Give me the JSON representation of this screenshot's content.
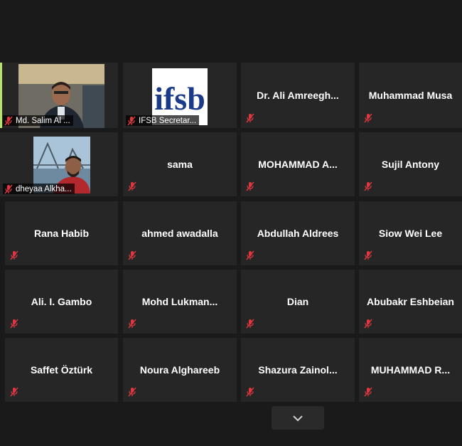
{
  "participants": [
    {
      "name": "Md. Salim Al ...",
      "type": "video"
    },
    {
      "name": "IFSB Secretar...",
      "type": "logo",
      "logo_text": "ifsb"
    },
    {
      "name": "Dr. Ali  Amreegh..."
    },
    {
      "name": "Muhammad Musa"
    },
    {
      "name": "dheyaa Alkha...",
      "type": "video"
    },
    {
      "name": "sama"
    },
    {
      "name": "MOHAMMAD  A..."
    },
    {
      "name": "Sujil Antony"
    },
    {
      "name": "Rana Habib"
    },
    {
      "name": "ahmed awadalla"
    },
    {
      "name": "Abdullah Aldrees"
    },
    {
      "name": "Siow Wei Lee"
    },
    {
      "name": "Ali. I. Gambo"
    },
    {
      "name": "Mohd  Lukman..."
    },
    {
      "name": "Dian"
    },
    {
      "name": "Abubakr Eshbeian"
    },
    {
      "name": "Saffet Öztürk"
    },
    {
      "name": "Noura Alghareeb"
    },
    {
      "name": "Shazura  Zainol..."
    },
    {
      "name": "MUHAMMAD  R..."
    }
  ],
  "colors": {
    "muted_icon": "#e0383e",
    "active_border": "#b6e36b",
    "tile_bg": "#262626"
  },
  "icons": {
    "mic": "mic-muted-icon",
    "scroll": "chevron-down-icon"
  }
}
